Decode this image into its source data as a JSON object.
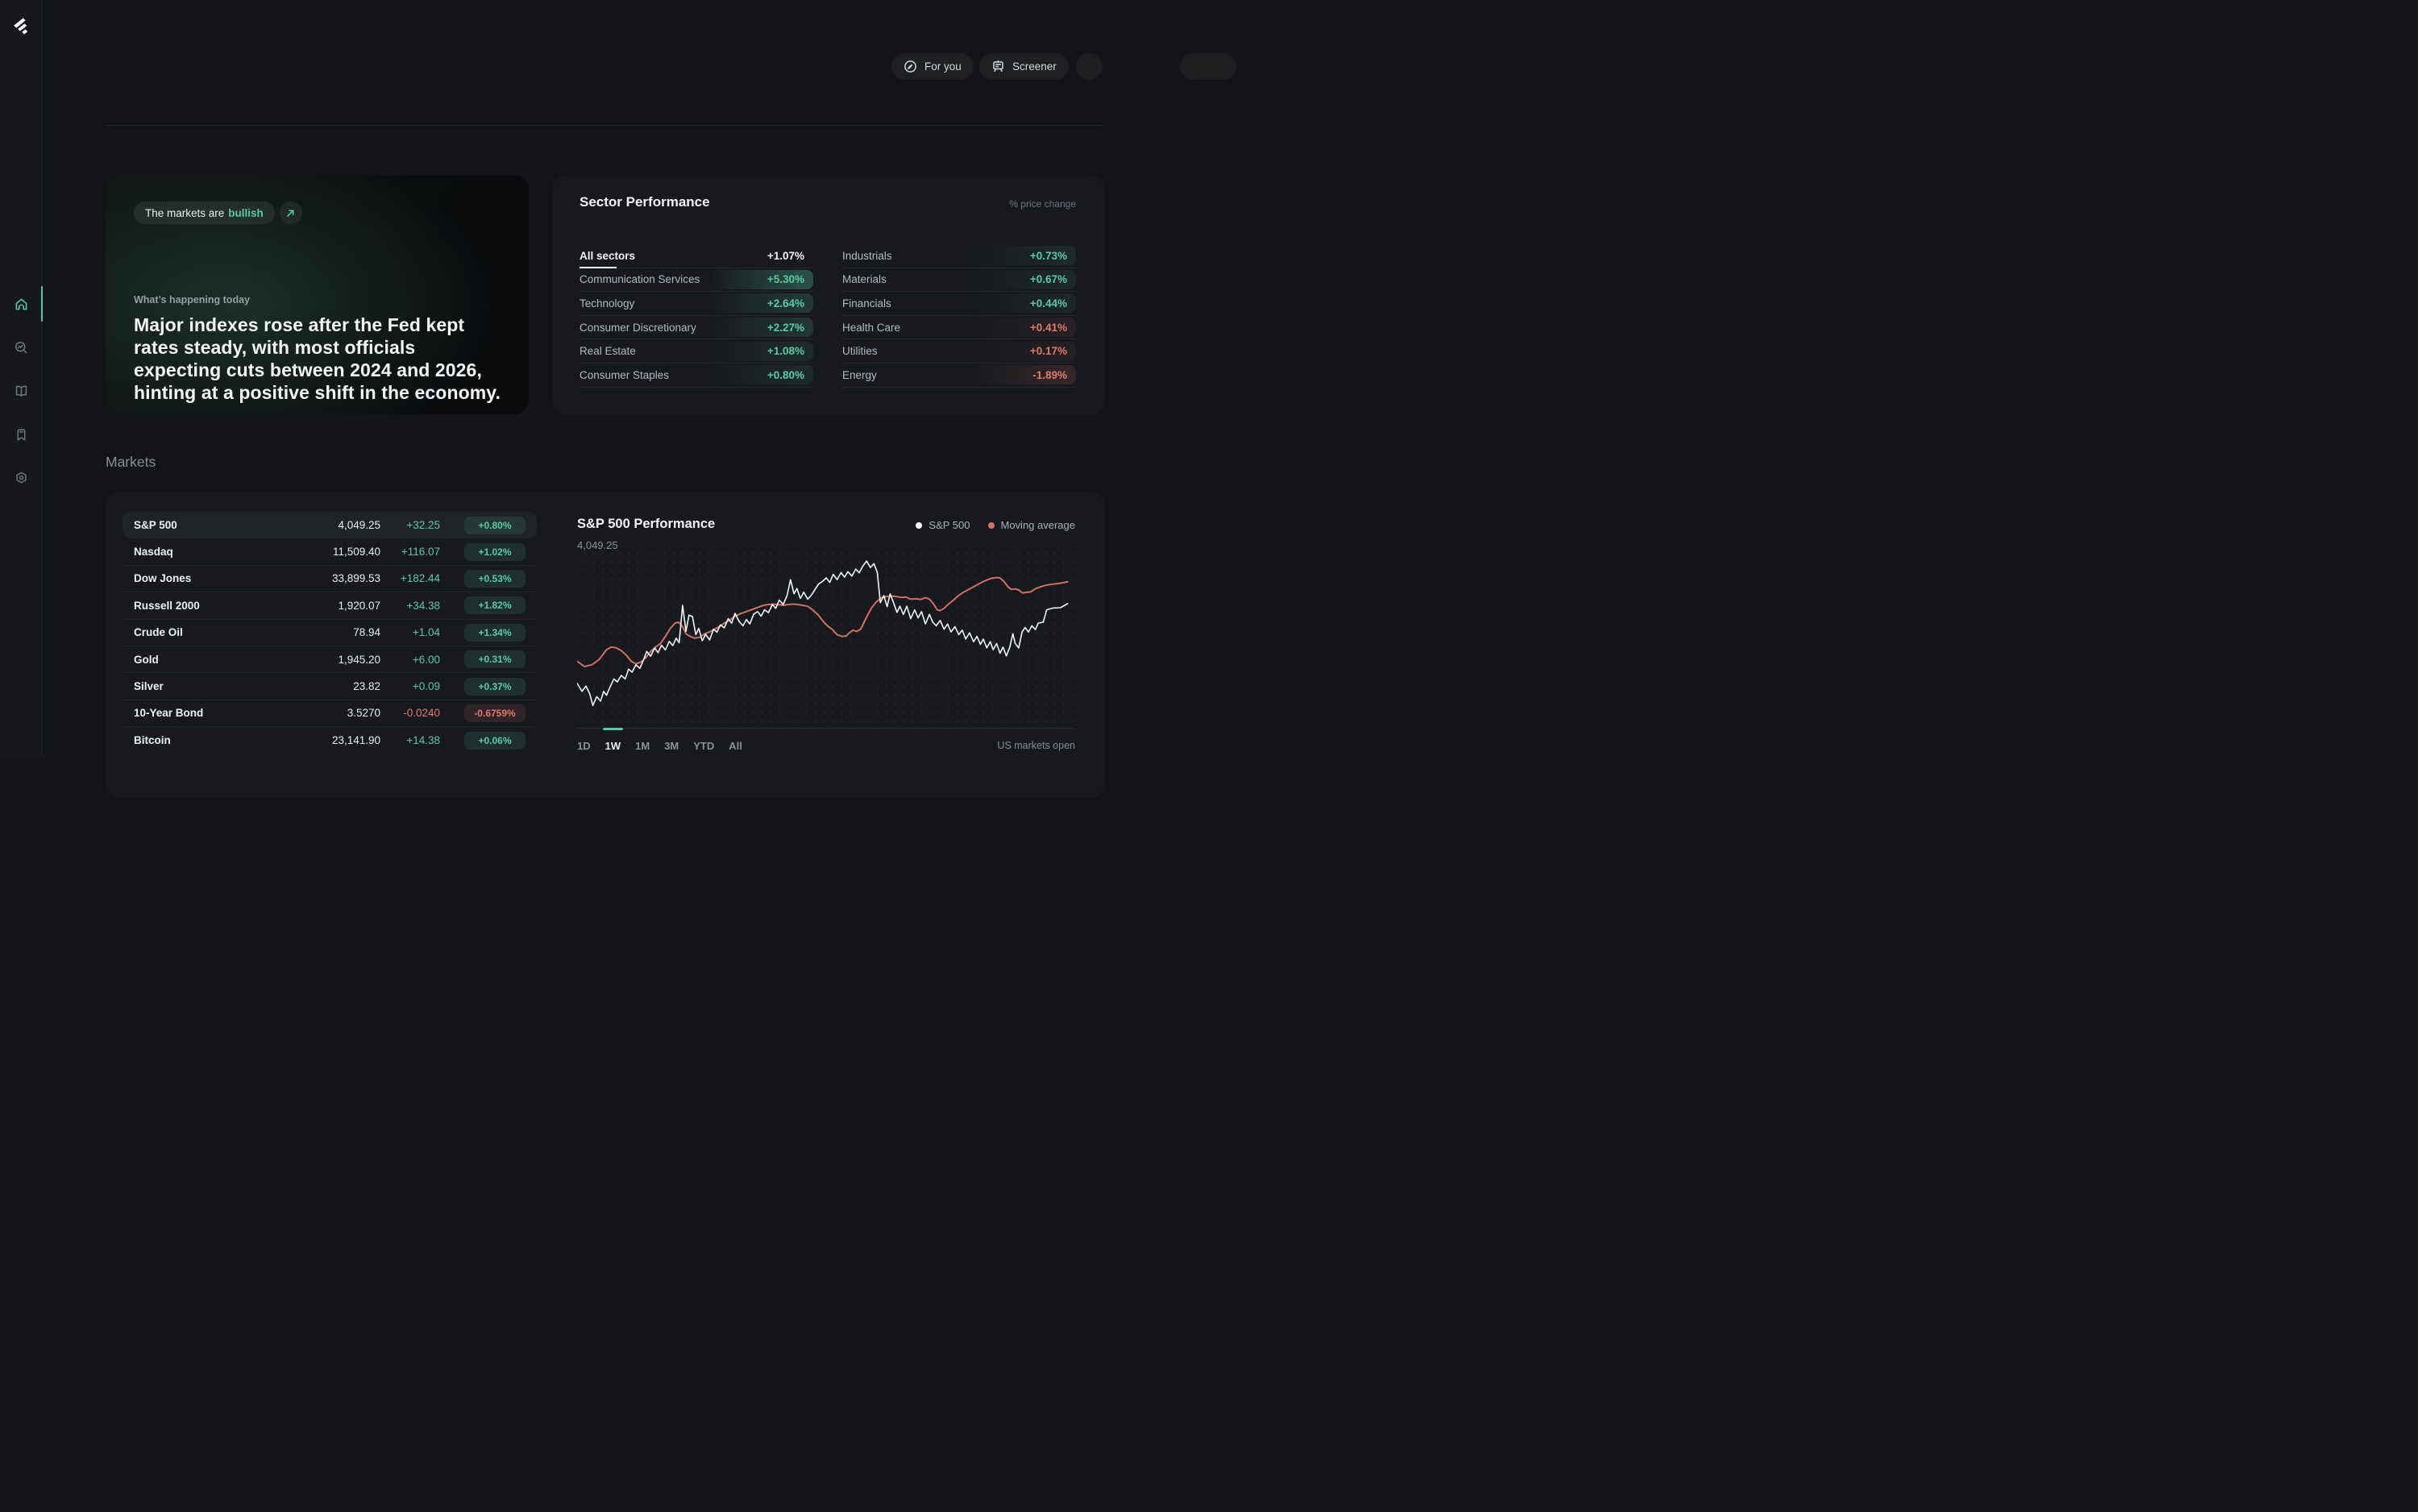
{
  "app": {
    "name": "markets-dashboard",
    "accent": "#52c9a0",
    "negative": "#e0786c",
    "background": "#121417",
    "card_background": "#17191e"
  },
  "sidebar": {
    "active": "home",
    "items": [
      {
        "id": "home",
        "icon": "home-icon",
        "active": true
      },
      {
        "id": "explore",
        "icon": "search-trend-icon",
        "active": false
      },
      {
        "id": "learn",
        "icon": "open-book-icon",
        "active": false
      },
      {
        "id": "bookmarks",
        "icon": "bookmark-icon",
        "active": false
      },
      {
        "id": "token",
        "icon": "hexagon-dot-icon",
        "active": false
      }
    ]
  },
  "header": {
    "for_you": "For you",
    "screener": "Screener"
  },
  "hero": {
    "pill_prefix": "The markets are",
    "pill_sentiment": "bullish",
    "kicker": "What’s happening today",
    "headline": "Major indexes rose after the Fed kept rates steady, with most officials expecting cuts between 2024 and 2026, hinting at a positive shift in the economy."
  },
  "sectors": {
    "title": "Sector Performance",
    "unit_label": "% price change",
    "left": [
      {
        "name": "All sectors",
        "value": "+1.07%",
        "tone": "neutral",
        "is_all": true
      },
      {
        "name": "Communication Services",
        "value": "+5.30%",
        "tone": "green"
      },
      {
        "name": "Technology",
        "value": "+2.64%",
        "tone": "green"
      },
      {
        "name": "Consumer Discretionary",
        "value": "+2.27%",
        "tone": "green"
      },
      {
        "name": "Real Estate",
        "value": "+1.08%",
        "tone": "green"
      },
      {
        "name": "Consumer Staples",
        "value": "+0.80%",
        "tone": "green"
      }
    ],
    "right": [
      {
        "name": "Industrials",
        "value": "+0.73%",
        "tone": "green"
      },
      {
        "name": "Materials",
        "value": "+0.67%",
        "tone": "green"
      },
      {
        "name": "Financials",
        "value": "+0.44%",
        "tone": "green"
      },
      {
        "name": "Health Care",
        "value": "+0.41%",
        "tone": "red"
      },
      {
        "name": "Utilities",
        "value": "+0.17%",
        "tone": "red"
      },
      {
        "name": "Energy",
        "value": "-1.89%",
        "tone": "red"
      }
    ]
  },
  "markets": {
    "heading": "Markets",
    "rows": [
      {
        "name": "S&P 500",
        "value": "4,049.25",
        "change": "+32.25",
        "pct": "+0.80%",
        "tone": "green",
        "highlighted": true
      },
      {
        "name": "Nasdaq",
        "value": "11,509.40",
        "change": "+116.07",
        "pct": "+1.02%",
        "tone": "green",
        "highlighted": false
      },
      {
        "name": "Dow Jones",
        "value": "33,899.53",
        "change": "+182.44",
        "pct": "+0.53%",
        "tone": "green",
        "highlighted": false
      },
      {
        "name": "Russell 2000",
        "value": "1,920.07",
        "change": "+34.38",
        "pct": "+1.82%",
        "tone": "green",
        "highlighted": false
      },
      {
        "name": "Crude Oil",
        "value": "78.94",
        "change": "+1.04",
        "pct": "+1.34%",
        "tone": "green",
        "highlighted": false
      },
      {
        "name": "Gold",
        "value": "1,945.20",
        "change": "+6.00",
        "pct": "+0.31%",
        "tone": "green",
        "highlighted": false
      },
      {
        "name": "Silver",
        "value": "23.82",
        "change": "+0.09",
        "pct": "+0.37%",
        "tone": "green",
        "highlighted": false
      },
      {
        "name": "10-Year Bond",
        "value": "3.5270",
        "change": "-0.0240",
        "pct": "-0.6759%",
        "tone": "red",
        "highlighted": false
      },
      {
        "name": "Bitcoin",
        "value": "23,141.90",
        "change": "+14.38",
        "pct": "+0.06%",
        "tone": "green",
        "highlighted": false
      }
    ]
  },
  "chart": {
    "title": "S&P 500 Performance",
    "subtitle": "4,049.25",
    "legend": [
      {
        "label": "S&P 500",
        "color": "#ffffff"
      },
      {
        "label": "Moving average",
        "color": "#d0746a"
      }
    ],
    "tabs": [
      "1D",
      "1W",
      "1M",
      "3M",
      "YTD",
      "All"
    ],
    "active_tab": "1W",
    "status": "US markets open"
  },
  "chart_data": {
    "type": "line",
    "title": "S&P 500 Performance",
    "last_value": 4049.25,
    "timeframe_selected": "1W",
    "legend_position": "top-right",
    "grid": "dot-pattern",
    "note": "points are [x, y] fractions of the plot area; y measured from the top edge (0 = high price, 1 = low price)",
    "series": [
      {
        "name": "S&P 500",
        "color": "#f2f5f6",
        "width": 1.6,
        "points": [
          [
            0.0,
            0.745
          ],
          [
            0.01,
            0.79
          ],
          [
            0.018,
            0.76
          ],
          [
            0.026,
            0.805
          ],
          [
            0.032,
            0.87
          ],
          [
            0.04,
            0.82
          ],
          [
            0.048,
            0.845
          ],
          [
            0.054,
            0.79
          ],
          [
            0.06,
            0.812
          ],
          [
            0.068,
            0.76
          ],
          [
            0.075,
            0.72
          ],
          [
            0.082,
            0.737
          ],
          [
            0.09,
            0.7
          ],
          [
            0.098,
            0.72
          ],
          [
            0.105,
            0.665
          ],
          [
            0.112,
            0.682
          ],
          [
            0.12,
            0.64
          ],
          [
            0.128,
            0.66
          ],
          [
            0.135,
            0.615
          ],
          [
            0.142,
            0.565
          ],
          [
            0.15,
            0.592
          ],
          [
            0.158,
            0.545
          ],
          [
            0.165,
            0.572
          ],
          [
            0.172,
            0.53
          ],
          [
            0.18,
            0.556
          ],
          [
            0.188,
            0.508
          ],
          [
            0.195,
            0.532
          ],
          [
            0.202,
            0.49
          ],
          [
            0.208,
            0.516
          ],
          [
            0.215,
            0.305
          ],
          [
            0.222,
            0.452
          ],
          [
            0.228,
            0.36
          ],
          [
            0.235,
            0.368
          ],
          [
            0.242,
            0.47
          ],
          [
            0.248,
            0.435
          ],
          [
            0.255,
            0.505
          ],
          [
            0.262,
            0.468
          ],
          [
            0.27,
            0.5
          ],
          [
            0.278,
            0.44
          ],
          [
            0.285,
            0.456
          ],
          [
            0.292,
            0.415
          ],
          [
            0.3,
            0.432
          ],
          [
            0.308,
            0.38
          ],
          [
            0.315,
            0.406
          ],
          [
            0.322,
            0.35
          ],
          [
            0.33,
            0.395
          ],
          [
            0.338,
            0.42
          ],
          [
            0.345,
            0.385
          ],
          [
            0.352,
            0.41
          ],
          [
            0.36,
            0.355
          ],
          [
            0.368,
            0.34
          ],
          [
            0.375,
            0.366
          ],
          [
            0.382,
            0.33
          ],
          [
            0.39,
            0.346
          ],
          [
            0.398,
            0.3
          ],
          [
            0.405,
            0.322
          ],
          [
            0.412,
            0.275
          ],
          [
            0.42,
            0.3
          ],
          [
            0.428,
            0.25
          ],
          [
            0.435,
            0.16
          ],
          [
            0.442,
            0.24
          ],
          [
            0.448,
            0.21
          ],
          [
            0.455,
            0.266
          ],
          [
            0.462,
            0.23
          ],
          [
            0.47,
            0.27
          ],
          [
            0.478,
            0.246
          ],
          [
            0.485,
            0.215
          ],
          [
            0.492,
            0.185
          ],
          [
            0.5,
            0.17
          ],
          [
            0.508,
            0.15
          ],
          [
            0.515,
            0.176
          ],
          [
            0.522,
            0.13
          ],
          [
            0.53,
            0.16
          ],
          [
            0.538,
            0.12
          ],
          [
            0.545,
            0.146
          ],
          [
            0.552,
            0.115
          ],
          [
            0.56,
            0.14
          ],
          [
            0.568,
            0.1
          ],
          [
            0.575,
            0.122
          ],
          [
            0.582,
            0.085
          ],
          [
            0.59,
            0.055
          ],
          [
            0.598,
            0.092
          ],
          [
            0.605,
            0.07
          ],
          [
            0.612,
            0.12
          ],
          [
            0.618,
            0.29
          ],
          [
            0.625,
            0.25
          ],
          [
            0.632,
            0.312
          ],
          [
            0.638,
            0.24
          ],
          [
            0.645,
            0.29
          ],
          [
            0.652,
            0.345
          ],
          [
            0.658,
            0.31
          ],
          [
            0.665,
            0.356
          ],
          [
            0.672,
            0.31
          ],
          [
            0.68,
            0.38
          ],
          [
            0.688,
            0.33
          ],
          [
            0.695,
            0.376
          ],
          [
            0.702,
            0.34
          ],
          [
            0.71,
            0.41
          ],
          [
            0.718,
            0.356
          ],
          [
            0.725,
            0.4
          ],
          [
            0.732,
            0.42
          ],
          [
            0.74,
            0.39
          ],
          [
            0.748,
            0.44
          ],
          [
            0.755,
            0.41
          ],
          [
            0.762,
            0.455
          ],
          [
            0.77,
            0.425
          ],
          [
            0.778,
            0.47
          ],
          [
            0.785,
            0.445
          ],
          [
            0.792,
            0.495
          ],
          [
            0.8,
            0.46
          ],
          [
            0.808,
            0.51
          ],
          [
            0.815,
            0.48
          ],
          [
            0.822,
            0.525
          ],
          [
            0.828,
            0.495
          ],
          [
            0.835,
            0.545
          ],
          [
            0.842,
            0.51
          ],
          [
            0.848,
            0.555
          ],
          [
            0.855,
            0.52
          ],
          [
            0.862,
            0.575
          ],
          [
            0.868,
            0.54
          ],
          [
            0.875,
            0.59
          ],
          [
            0.882,
            0.54
          ],
          [
            0.888,
            0.465
          ],
          [
            0.893,
            0.52
          ],
          [
            0.9,
            0.545
          ],
          [
            0.907,
            0.455
          ],
          [
            0.913,
            0.43
          ],
          [
            0.92,
            0.455
          ],
          [
            0.927,
            0.42
          ],
          [
            0.934,
            0.442
          ],
          [
            0.94,
            0.405
          ],
          [
            0.95,
            0.4
          ],
          [
            0.957,
            0.33
          ],
          [
            0.97,
            0.32
          ],
          [
            0.985,
            0.318
          ],
          [
            1.0,
            0.295
          ]
        ]
      },
      {
        "name": "Moving average",
        "color": "#cf7065",
        "width": 2.0,
        "points": [
          [
            0.0,
            0.62
          ],
          [
            0.015,
            0.65
          ],
          [
            0.03,
            0.64
          ],
          [
            0.045,
            0.61
          ],
          [
            0.06,
            0.555
          ],
          [
            0.07,
            0.54
          ],
          [
            0.08,
            0.545
          ],
          [
            0.09,
            0.56
          ],
          [
            0.1,
            0.585
          ],
          [
            0.11,
            0.62
          ],
          [
            0.12,
            0.635
          ],
          [
            0.13,
            0.625
          ],
          [
            0.14,
            0.6
          ],
          [
            0.15,
            0.565
          ],
          [
            0.16,
            0.54
          ],
          [
            0.17,
            0.52
          ],
          [
            0.18,
            0.48
          ],
          [
            0.19,
            0.435
          ],
          [
            0.2,
            0.405
          ],
          [
            0.207,
            0.4
          ],
          [
            0.215,
            0.425
          ],
          [
            0.222,
            0.465
          ],
          [
            0.23,
            0.48
          ],
          [
            0.24,
            0.49
          ],
          [
            0.25,
            0.485
          ],
          [
            0.26,
            0.465
          ],
          [
            0.27,
            0.455
          ],
          [
            0.28,
            0.44
          ],
          [
            0.29,
            0.425
          ],
          [
            0.3,
            0.405
          ],
          [
            0.31,
            0.39
          ],
          [
            0.32,
            0.37
          ],
          [
            0.33,
            0.355
          ],
          [
            0.34,
            0.345
          ],
          [
            0.35,
            0.335
          ],
          [
            0.36,
            0.325
          ],
          [
            0.37,
            0.315
          ],
          [
            0.38,
            0.305
          ],
          [
            0.39,
            0.3
          ],
          [
            0.4,
            0.298
          ],
          [
            0.41,
            0.3
          ],
          [
            0.42,
            0.305
          ],
          [
            0.43,
            0.3
          ],
          [
            0.44,
            0.298
          ],
          [
            0.45,
            0.3
          ],
          [
            0.46,
            0.305
          ],
          [
            0.47,
            0.31
          ],
          [
            0.48,
            0.33
          ],
          [
            0.49,
            0.355
          ],
          [
            0.5,
            0.39
          ],
          [
            0.51,
            0.42
          ],
          [
            0.52,
            0.44
          ],
          [
            0.53,
            0.47
          ],
          [
            0.54,
            0.48
          ],
          [
            0.548,
            0.478
          ],
          [
            0.555,
            0.46
          ],
          [
            0.562,
            0.445
          ],
          [
            0.57,
            0.452
          ],
          [
            0.578,
            0.44
          ],
          [
            0.585,
            0.4
          ],
          [
            0.592,
            0.36
          ],
          [
            0.6,
            0.32
          ],
          [
            0.61,
            0.285
          ],
          [
            0.62,
            0.262
          ],
          [
            0.63,
            0.255
          ],
          [
            0.64,
            0.252
          ],
          [
            0.65,
            0.255
          ],
          [
            0.66,
            0.26
          ],
          [
            0.67,
            0.258
          ],
          [
            0.68,
            0.27
          ],
          [
            0.69,
            0.268
          ],
          [
            0.7,
            0.272
          ],
          [
            0.71,
            0.262
          ],
          [
            0.718,
            0.27
          ],
          [
            0.726,
            0.295
          ],
          [
            0.734,
            0.33
          ],
          [
            0.74,
            0.335
          ],
          [
            0.748,
            0.322
          ],
          [
            0.756,
            0.3
          ],
          [
            0.765,
            0.28
          ],
          [
            0.775,
            0.255
          ],
          [
            0.785,
            0.235
          ],
          [
            0.795,
            0.22
          ],
          [
            0.805,
            0.205
          ],
          [
            0.815,
            0.19
          ],
          [
            0.825,
            0.175
          ],
          [
            0.835,
            0.162
          ],
          [
            0.845,
            0.152
          ],
          [
            0.855,
            0.148
          ],
          [
            0.862,
            0.15
          ],
          [
            0.87,
            0.17
          ],
          [
            0.878,
            0.2
          ],
          [
            0.885,
            0.215
          ],
          [
            0.892,
            0.212
          ],
          [
            0.9,
            0.218
          ],
          [
            0.908,
            0.235
          ],
          [
            0.915,
            0.232
          ],
          [
            0.925,
            0.228
          ],
          [
            0.935,
            0.21
          ],
          [
            0.945,
            0.2
          ],
          [
            0.955,
            0.192
          ],
          [
            0.97,
            0.185
          ],
          [
            0.985,
            0.18
          ],
          [
            1.0,
            0.172
          ]
        ]
      }
    ]
  }
}
